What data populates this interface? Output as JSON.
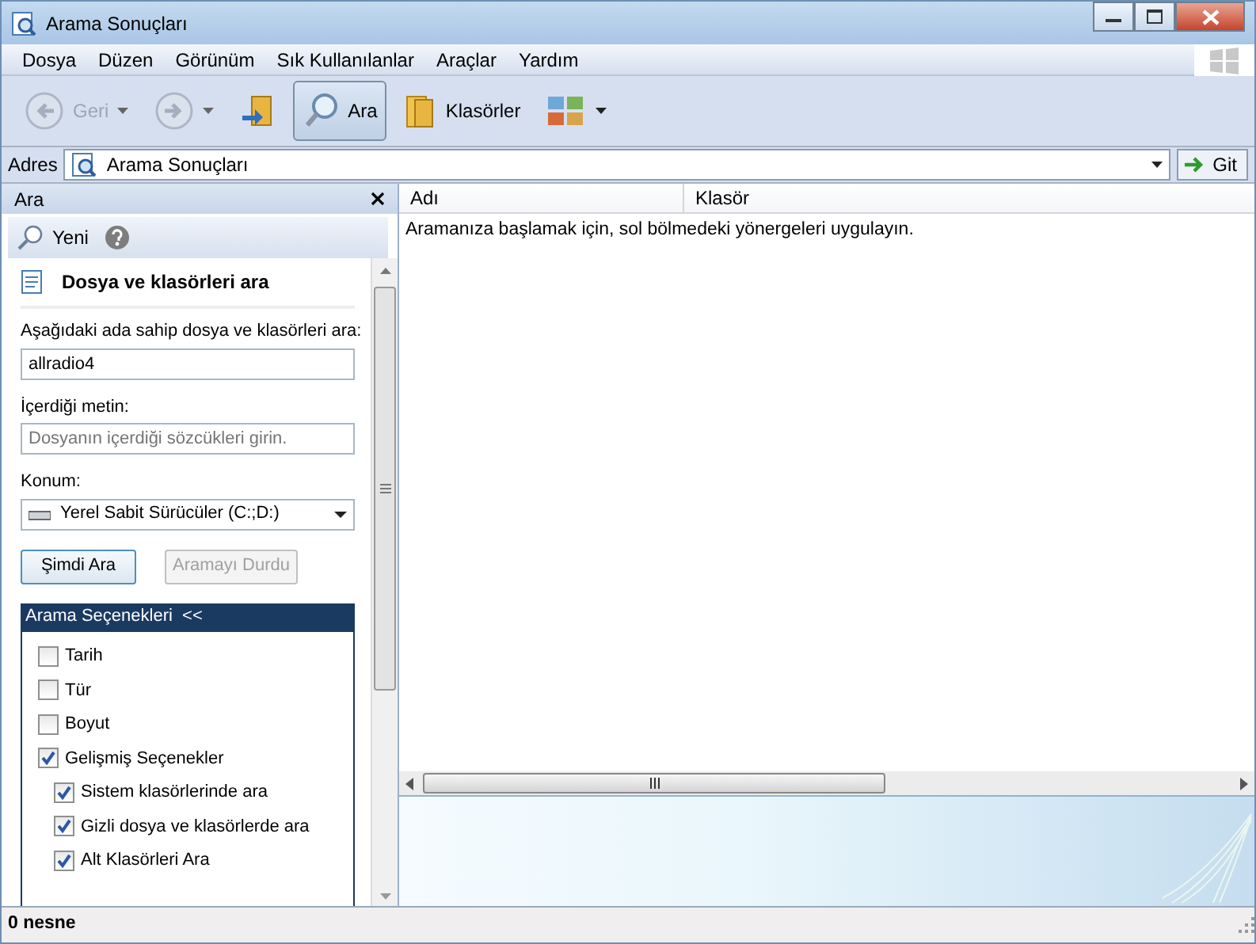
{
  "window": {
    "title": "Arama Sonuçları"
  },
  "menu": [
    "Dosya",
    "Düzen",
    "Görünüm",
    "Sık Kullanılanlar",
    "Araçlar",
    "Yardım"
  ],
  "toolbar": [
    {
      "kind": "back",
      "label": "Geri",
      "disabled": true
    },
    {
      "kind": "forward",
      "disabled": true
    },
    {
      "kind": "up"
    },
    {
      "kind": "search",
      "label": "Ara",
      "selected": true
    },
    {
      "kind": "folders",
      "label": "Klasörler",
      "selected": false
    },
    {
      "kind": "views"
    }
  ],
  "address": {
    "label": "Adres",
    "value": "Arama Sonuçları",
    "go": "Git"
  },
  "search_pane": {
    "title": "Ara",
    "new_label": "Yeni",
    "heading": "Dosya ve klasörleri ara",
    "name_label": "Aşağıdaki ada sahip dosya ve klasörleri ara:",
    "name_value": "allradio4",
    "text_label": "İçerdiği metin:",
    "text_placeholder": "Dosyanın içerdiği sözcükleri girin.",
    "location_label": "Konum:",
    "location_value": "Yerel Sabit Sürücüler (C:;D:)",
    "buttons": [
      {
        "label": "Şimdi Ara",
        "disabled": false
      },
      {
        "label": "Aramayı Durdu",
        "disabled": true
      }
    ],
    "options_title": "Arama Seçenekleri  <<",
    "options": [
      {
        "label": "Tarih",
        "checked": false
      },
      {
        "label": "Tür",
        "checked": false
      },
      {
        "label": "Boyut",
        "checked": false
      },
      {
        "label": "Gelişmiş Seçenekler",
        "checked": true,
        "children": [
          {
            "label": "Sistem klasörlerinde ara",
            "checked": true
          },
          {
            "label": "Gizli dosya ve klasörlerde ara",
            "checked": true
          },
          {
            "label": "Alt Klasörleri Ara",
            "checked": true
          }
        ]
      }
    ]
  },
  "results": {
    "columns": [
      "Adı",
      "Klasör"
    ],
    "message": "Aramanıza başlamak için, sol bölmedeki yönergeleri uygulayın."
  },
  "status_bar": {
    "text": "0 nesne"
  }
}
